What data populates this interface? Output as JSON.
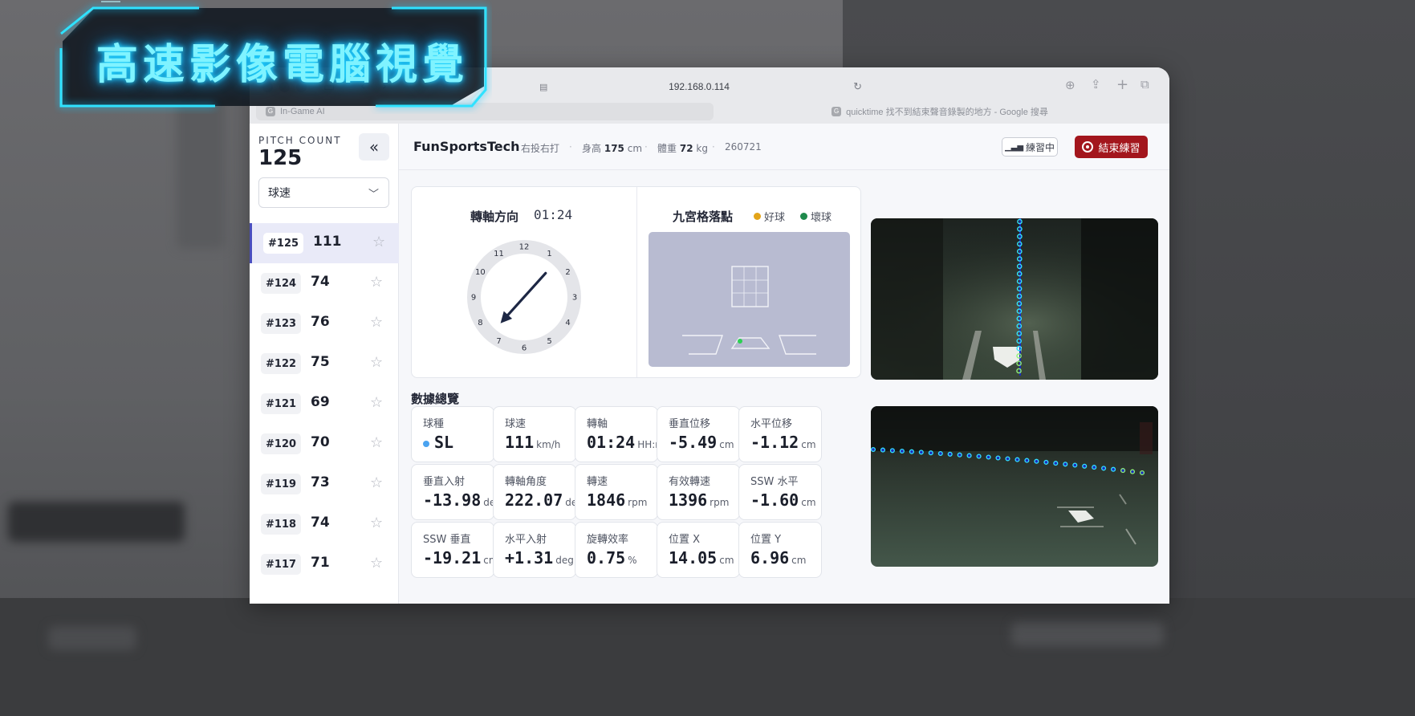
{
  "overlay": {
    "title": "高速影像電腦視覺"
  },
  "browser": {
    "url": "192.168.0.114",
    "tabs": [
      {
        "label": "In-Game AI",
        "favicon": "G"
      },
      {
        "label": "quicktime 找不到結束聲音錄製的地方 - Google 搜尋",
        "favicon": "G"
      }
    ]
  },
  "sidebar": {
    "pitch_count_label": "PITCH COUNT",
    "pitch_count": "125",
    "collapse_glyph": "«",
    "metric_select": "球速",
    "pitches": [
      {
        "id": "#125",
        "speed": "111",
        "active": true
      },
      {
        "id": "#124",
        "speed": "74"
      },
      {
        "id": "#123",
        "speed": "76"
      },
      {
        "id": "#122",
        "speed": "75"
      },
      {
        "id": "#121",
        "speed": "69"
      },
      {
        "id": "#120",
        "speed": "70"
      },
      {
        "id": "#119",
        "speed": "73"
      },
      {
        "id": "#118",
        "speed": "74"
      },
      {
        "id": "#117",
        "speed": "71"
      }
    ]
  },
  "header": {
    "brand": "FunSportsTech",
    "hand": "右投右打",
    "height_label": "身高",
    "height_value": "175",
    "height_unit": "cm",
    "weight_label": "體重",
    "weight_value": "72",
    "weight_unit": "kg",
    "session_id": "260721",
    "status": "練習中",
    "end_button": "結束練習"
  },
  "spin_axis": {
    "title": "轉軸方向",
    "time": "01:24",
    "hour_marks": [
      "12",
      "1",
      "2",
      "3",
      "4",
      "5",
      "6",
      "7",
      "8",
      "9",
      "10",
      "11"
    ],
    "arrow_clock": "01:24"
  },
  "zone": {
    "title": "九宮格落點",
    "legend": [
      {
        "label": "好球",
        "color": "#e3a419"
      },
      {
        "label": "壞球",
        "color": "#1f8a4c"
      }
    ]
  },
  "data_section": {
    "title": "數據總覽",
    "stats": [
      {
        "label": "球種",
        "value": "SL",
        "unit": "",
        "pitch_type_color": "#4aa3f0"
      },
      {
        "label": "球速",
        "value": "111",
        "unit": "km/h"
      },
      {
        "label": "轉軸",
        "value": "01:24",
        "unit": "HH:mm"
      },
      {
        "label": "垂直位移",
        "value": "-5.49",
        "unit": "cm"
      },
      {
        "label": "水平位移",
        "value": "-1.12",
        "unit": "cm"
      },
      {
        "label": "垂直入射",
        "value": "-13.98",
        "unit": "deg"
      },
      {
        "label": "轉軸角度",
        "value": "222.07",
        "unit": "deg"
      },
      {
        "label": "轉速",
        "value": "1846",
        "unit": "rpm"
      },
      {
        "label": "有效轉速",
        "value": "1396",
        "unit": "rpm"
      },
      {
        "label": "SSW 水平",
        "value": "-1.60",
        "unit": "cm"
      },
      {
        "label": "SSW 垂直",
        "value": "-19.21",
        "unit": "cm"
      },
      {
        "label": "水平入射",
        "value": "+1.31",
        "unit": "deg"
      },
      {
        "label": "旋轉效率",
        "value": "0.75",
        "unit": "%"
      },
      {
        "label": "位置 X",
        "value": "14.05",
        "unit": "cm"
      },
      {
        "label": "位置 Y",
        "value": "6.96",
        "unit": "cm"
      }
    ]
  },
  "colors": {
    "accent": "#4a4fbf",
    "end_button": "#a3161d",
    "neon": "#7ff3ff",
    "trajectory": "#33e0ff"
  }
}
